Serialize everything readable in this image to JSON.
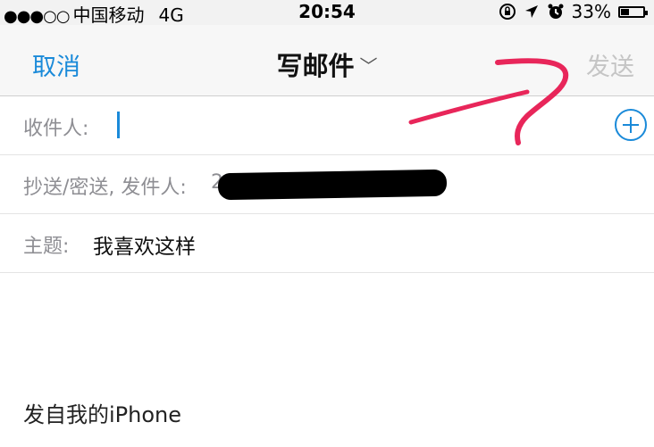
{
  "status_bar": {
    "signal": "●●●○○",
    "carrier": "中国移动",
    "network": "4G",
    "time": "20:54",
    "battery": "33%",
    "icons": [
      "lock-rotation-icon",
      "location-arrow-icon",
      "alarm-icon",
      "battery-icon"
    ]
  },
  "nav": {
    "cancel": "取消",
    "title": "写邮件",
    "title_chevron": "﹀",
    "send": "发送"
  },
  "form": {
    "to_label": "收件人:",
    "cc_label": "抄送/密送, 发件人:",
    "cc_partial": "2",
    "subject_label": "主题:",
    "subject_value": "我喜欢这样"
  },
  "body": {
    "signature": "发自我的iPhone"
  },
  "colors": {
    "accent": "#1a8ad9",
    "disabled": "#c5c5c5",
    "annotation": "#e8265a"
  }
}
